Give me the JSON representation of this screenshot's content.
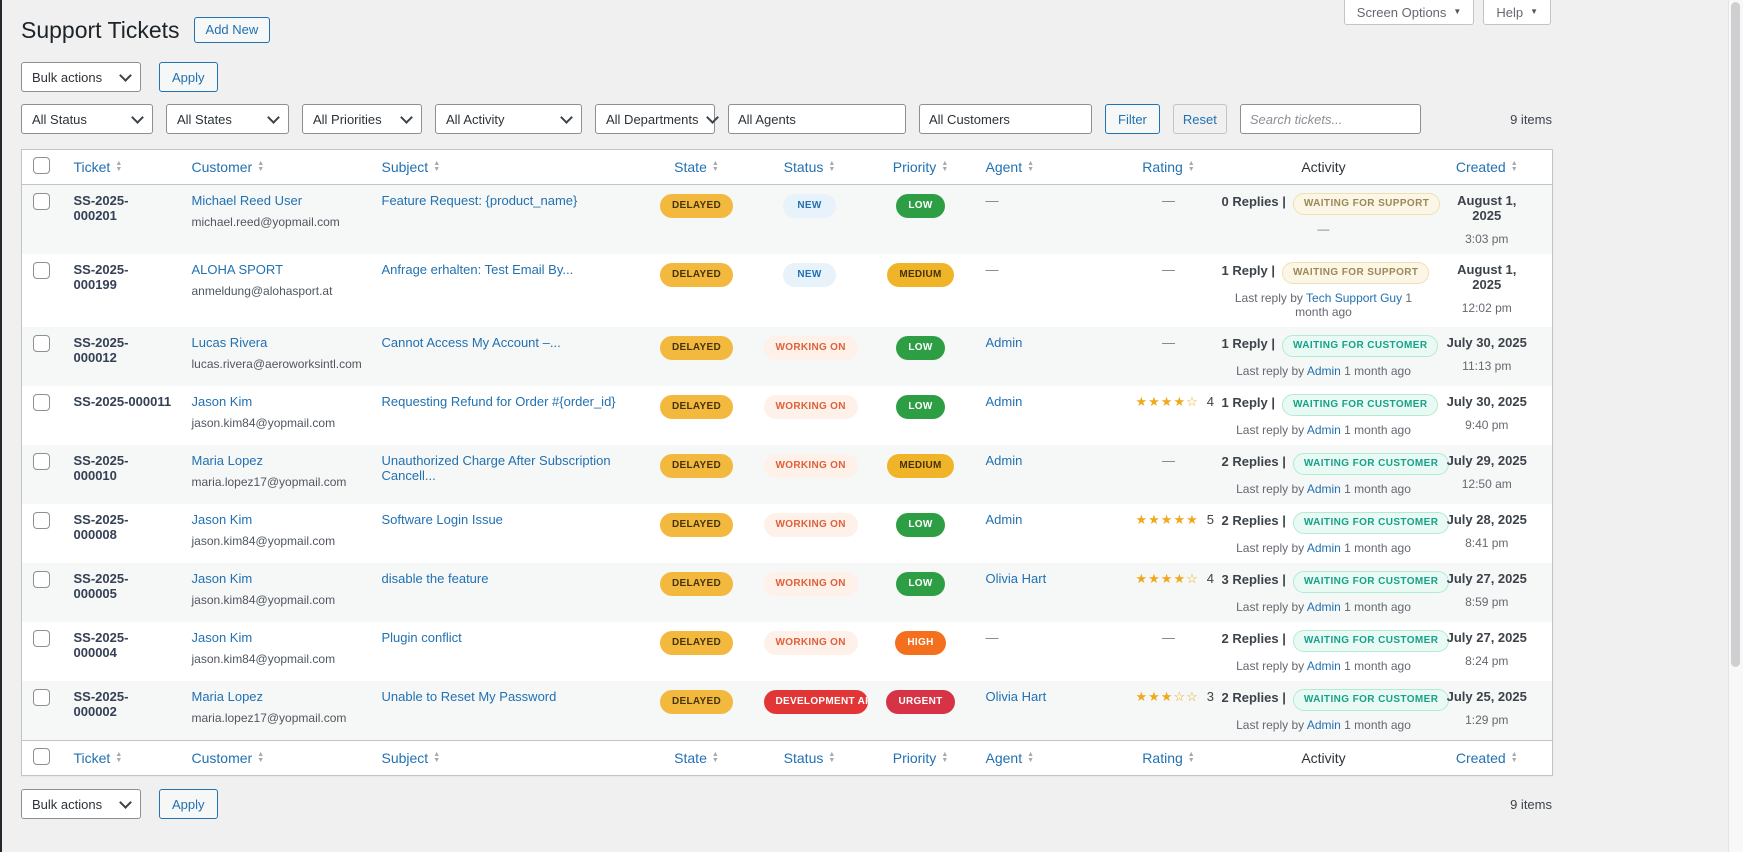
{
  "page": {
    "title": "Support Tickets",
    "add_new_label": "Add New",
    "screen_options_label": "Screen Options",
    "help_label": "Help"
  },
  "icons": {
    "caret_down": "▼",
    "sort_up": "▲",
    "sort_down": "▼"
  },
  "toolbar": {
    "bulk_actions_label": "Bulk actions",
    "apply_label": "Apply"
  },
  "filters": {
    "status": "All Status",
    "states": "All States",
    "priorities": "All Priorities",
    "activity": "All Activity",
    "departments": "All Departments",
    "agents": "All Agents",
    "customers": "All Customers",
    "filter_label": "Filter",
    "reset_label": "Reset",
    "search_placeholder": "Search tickets..."
  },
  "items_count": "9 items",
  "colors": {
    "accent": "#2271b1",
    "state_delayed": "#f2b93e",
    "priority_low": "#2e9e44",
    "priority_medium": "#f0b429",
    "priority_high": "#f4701e",
    "priority_urgent": "#d63446",
    "status_dev": "#e23636",
    "badge_support_text": "#9a8a56",
    "badge_customer_text": "#18a189",
    "stars": "#f0a81c"
  },
  "table": {
    "labels": {
      "empty": "—",
      "last_reply_prefix": "Last reply by"
    },
    "columns": [
      {
        "key": "ticket",
        "label": "Ticket",
        "sortable": true
      },
      {
        "key": "customer",
        "label": "Customer",
        "sortable": true
      },
      {
        "key": "subject",
        "label": "Subject",
        "sortable": true
      },
      {
        "key": "state",
        "label": "State",
        "sortable": true
      },
      {
        "key": "status",
        "label": "Status",
        "sortable": true
      },
      {
        "key": "priority",
        "label": "Priority",
        "sortable": true
      },
      {
        "key": "agent",
        "label": "Agent",
        "sortable": true
      },
      {
        "key": "rating",
        "label": "Rating",
        "sortable": true
      },
      {
        "key": "activity",
        "label": "Activity",
        "sortable": false
      },
      {
        "key": "created",
        "label": "Created",
        "sortable": true
      }
    ],
    "rows": [
      {
        "ticket": "SS-2025-000201",
        "customer": "Michael Reed User",
        "email": "michael.reed@yopmail.com",
        "subject": "Feature Request: {product_name}",
        "state": "DELAYED",
        "status": {
          "label": "NEW",
          "type": "new"
        },
        "priority": {
          "label": "LOW",
          "type": "low"
        },
        "agent": null,
        "rating": null,
        "replies": "0 Replies |",
        "activity_badge": {
          "label": "WAITING FOR SUPPORT",
          "type": "support"
        },
        "last_reply": null,
        "created_date": "August 1, 2025",
        "created_time": "3:03 pm"
      },
      {
        "ticket": "SS-2025-000199",
        "customer": "ALOHA SPORT",
        "email": "anmeldung@alohasport.at",
        "subject": "Anfrage erhalten: Test Email By...",
        "state": "DELAYED",
        "status": {
          "label": "NEW",
          "type": "new"
        },
        "priority": {
          "label": "MEDIUM",
          "type": "medium"
        },
        "agent": null,
        "rating": null,
        "replies": "1 Reply |",
        "activity_badge": {
          "label": "WAITING FOR SUPPORT",
          "type": "support"
        },
        "last_reply": {
          "by": "Tech Support Guy",
          "ago": "1 month ago"
        },
        "created_date": "August 1, 2025",
        "created_time": "12:02 pm"
      },
      {
        "ticket": "SS-2025-000012",
        "customer": "Lucas Rivera",
        "email": "lucas.rivera@aeroworksintl.com",
        "subject": "Cannot Access My Account –...",
        "state": "DELAYED",
        "status": {
          "label": "WORKING ON",
          "type": "working"
        },
        "priority": {
          "label": "LOW",
          "type": "low"
        },
        "agent": "Admin",
        "rating": null,
        "replies": "1 Reply |",
        "activity_badge": {
          "label": "WAITING FOR CUSTOMER",
          "type": "customer"
        },
        "last_reply": {
          "by": "Admin",
          "ago": "1 month ago"
        },
        "created_date": "July 30, 2025",
        "created_time": "11:13 pm"
      },
      {
        "ticket": "SS-2025-000011",
        "customer": "Jason Kim",
        "email": "jason.kim84@yopmail.com",
        "subject": "Requesting Refund for Order #{order_id}",
        "state": "DELAYED",
        "status": {
          "label": "WORKING ON",
          "type": "working"
        },
        "priority": {
          "label": "LOW",
          "type": "low"
        },
        "agent": "Admin",
        "rating": {
          "stars": "★★★★☆",
          "value": "4"
        },
        "replies": "1 Reply |",
        "activity_badge": {
          "label": "WAITING FOR CUSTOMER",
          "type": "customer"
        },
        "last_reply": {
          "by": "Admin",
          "ago": "1 month ago"
        },
        "created_date": "July 30, 2025",
        "created_time": "9:40 pm"
      },
      {
        "ticket": "SS-2025-000010",
        "customer": "Maria Lopez",
        "email": "maria.lopez17@yopmail.com",
        "subject": "Unauthorized Charge After Subscription Cancell...",
        "state": "DELAYED",
        "status": {
          "label": "WORKING ON",
          "type": "working"
        },
        "priority": {
          "label": "MEDIUM",
          "type": "medium"
        },
        "agent": "Admin",
        "rating": null,
        "replies": "2 Replies |",
        "activity_badge": {
          "label": "WAITING FOR CUSTOMER",
          "type": "customer"
        },
        "last_reply": {
          "by": "Admin",
          "ago": "1 month ago"
        },
        "created_date": "July 29, 2025",
        "created_time": "12:50 am"
      },
      {
        "ticket": "SS-2025-000008",
        "customer": "Jason Kim",
        "email": "jason.kim84@yopmail.com",
        "subject": "Software Login Issue",
        "state": "DELAYED",
        "status": {
          "label": "WORKING ON",
          "type": "working"
        },
        "priority": {
          "label": "LOW",
          "type": "low"
        },
        "agent": "Admin",
        "rating": {
          "stars": "★★★★★",
          "value": "5"
        },
        "replies": "2 Replies |",
        "activity_badge": {
          "label": "WAITING FOR CUSTOMER",
          "type": "customer"
        },
        "last_reply": {
          "by": "Admin",
          "ago": "1 month ago"
        },
        "created_date": "July 28, 2025",
        "created_time": "8:41 pm"
      },
      {
        "ticket": "SS-2025-000005",
        "customer": "Jason Kim",
        "email": "jason.kim84@yopmail.com",
        "subject": "disable the feature",
        "state": "DELAYED",
        "status": {
          "label": "WORKING ON",
          "type": "working"
        },
        "priority": {
          "label": "LOW",
          "type": "low"
        },
        "agent": "Olivia Hart",
        "rating": {
          "stars": "★★★★☆",
          "value": "4"
        },
        "replies": "3 Replies |",
        "activity_badge": {
          "label": "WAITING FOR CUSTOMER",
          "type": "customer"
        },
        "last_reply": {
          "by": "Admin",
          "ago": "1 month ago"
        },
        "created_date": "July 27, 2025",
        "created_time": "8:59 pm"
      },
      {
        "ticket": "SS-2025-000004",
        "customer": "Jason Kim",
        "email": "jason.kim84@yopmail.com",
        "subject": "Plugin conflict",
        "state": "DELAYED",
        "status": {
          "label": "WORKING ON",
          "type": "working"
        },
        "priority": {
          "label": "HIGH",
          "type": "high"
        },
        "agent": null,
        "rating": null,
        "replies": "2 Replies |",
        "activity_badge": {
          "label": "WAITING FOR CUSTOMER",
          "type": "customer"
        },
        "last_reply": {
          "by": "Admin",
          "ago": "1 month ago"
        },
        "created_date": "July 27, 2025",
        "created_time": "8:24 pm"
      },
      {
        "ticket": "SS-2025-000002",
        "customer": "Maria Lopez",
        "email": "maria.lopez17@yopmail.com",
        "subject": "Unable to Reset My Password",
        "state": "DELAYED",
        "status": {
          "label": "DEVELOPMENT ARE",
          "type": "dev"
        },
        "priority": {
          "label": "URGENT",
          "type": "urgent"
        },
        "agent": "Olivia Hart",
        "rating": {
          "stars": "★★★☆☆",
          "value": "3"
        },
        "replies": "2 Replies |",
        "activity_badge": {
          "label": "WAITING FOR CUSTOMER",
          "type": "customer"
        },
        "last_reply": {
          "by": "Admin",
          "ago": "1 month ago"
        },
        "created_date": "July 25, 2025",
        "created_time": "1:29 pm"
      }
    ]
  }
}
